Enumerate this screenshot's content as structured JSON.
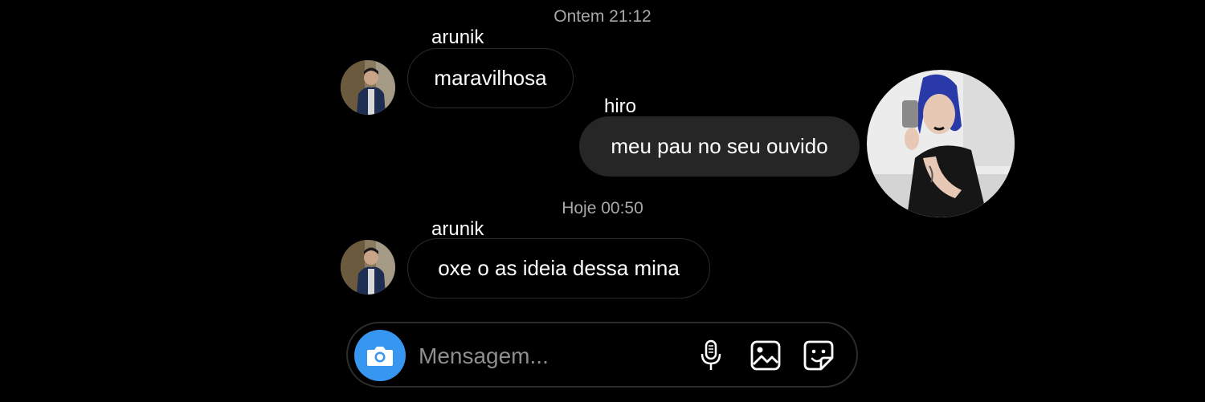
{
  "thread": {
    "timestamps": [
      "Ontem 21:12",
      "Hoje 00:50"
    ],
    "messages": [
      {
        "sender": "arunik",
        "text": "maravilhosa"
      },
      {
        "sender": "hiro",
        "text": "meu pau no seu ouvido"
      },
      {
        "sender": "arunik",
        "text": "oxe o as ideia dessa mina"
      }
    ]
  },
  "composer": {
    "placeholder": "Mensagem...",
    "icons": [
      "camera-icon",
      "microphone-icon",
      "gallery-icon",
      "sticker-icon"
    ]
  },
  "colors": {
    "background": "#000000",
    "incoming_border": "#2a2a2a",
    "outgoing_bubble": "#262626",
    "accent": "#3797f0",
    "timestamp": "#a8a8a8",
    "placeholder": "#8e8e8e"
  }
}
